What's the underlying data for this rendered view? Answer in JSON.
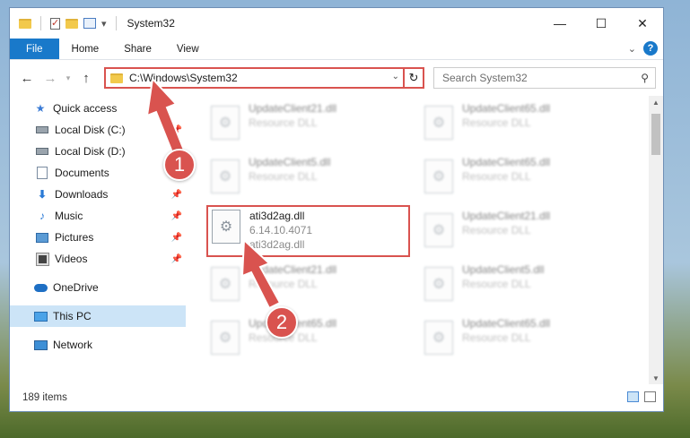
{
  "window": {
    "title": "System32",
    "controls": {
      "minimize": "—",
      "maximize": "☐",
      "close": "✕"
    }
  },
  "ribbon": {
    "tabs": [
      "File",
      "Home",
      "Share",
      "View"
    ],
    "help": "?"
  },
  "address": {
    "path": "C:\\Windows\\System32",
    "search_placeholder": "Search System32"
  },
  "sidebar": {
    "quick_access": "Quick access",
    "items": [
      {
        "label": "Local Disk (C:)",
        "pinned": true
      },
      {
        "label": "Local Disk (D:)",
        "pinned": false
      },
      {
        "label": "Documents",
        "pinned": true
      },
      {
        "label": "Downloads",
        "pinned": true
      },
      {
        "label": "Music",
        "pinned": true
      },
      {
        "label": "Pictures",
        "pinned": true
      },
      {
        "label": "Videos",
        "pinned": true
      }
    ],
    "onedrive": "OneDrive",
    "this_pc": "This PC",
    "network": "Network"
  },
  "files": {
    "left": [
      {
        "name": "UpdateClient21.dll",
        "type": "Resource DLL"
      },
      {
        "name": "UpdateClient5.dll",
        "type": "Resource DLL"
      },
      {
        "name": "ati3d2ag.dll",
        "version": "6.14.10.4071",
        "desc": "ati3d2ag.dll"
      },
      {
        "name": "UpdateClient21.dll",
        "type": "Resource DLL"
      },
      {
        "name": "UpdateClient65.dll",
        "type": "Resource DLL"
      }
    ],
    "right": [
      {
        "name": "UpdateClient65.dll",
        "type": "Resource DLL"
      },
      {
        "name": "UpdateClient65.dll",
        "type": "Resource DLL"
      },
      {
        "name": "UpdateClient21.dll",
        "type": "Resource DLL"
      },
      {
        "name": "UpdateClient5.dll",
        "type": "Resource DLL"
      },
      {
        "name": "UpdateClient65.dll",
        "type": "Resource DLL"
      }
    ]
  },
  "status": {
    "items": "189 items"
  },
  "callouts": {
    "one": "1",
    "two": "2",
    "color": "#d9534f"
  }
}
